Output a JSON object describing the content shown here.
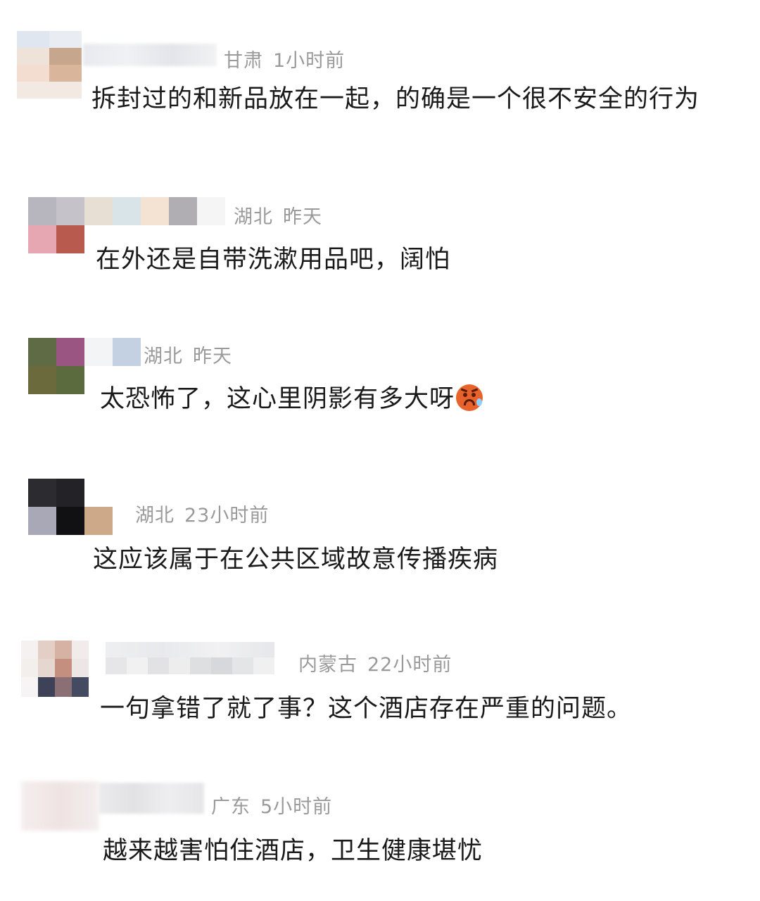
{
  "comments": [
    {
      "region": "甘肃",
      "time": "1小时前",
      "text": "拆封过的和新品放在一起，的确是一个很不安全的行为"
    },
    {
      "region": "湖北",
      "time": "昨天",
      "text": "在外还是自带洗漱用品吧，阔怕"
    },
    {
      "region": "湖北",
      "time": "昨天",
      "text": "太恐怖了，这心里阴影有多大呀",
      "emoji": "angry-crying-emoji-icon"
    },
    {
      "region": "湖北",
      "time": "23小时前",
      "text": "这应该属于在公共区域故意传播疾病"
    },
    {
      "region": "内蒙古",
      "time": "22小时前",
      "text": "一句拿错了就了事？这个酒店存在严重的问题。"
    },
    {
      "region": "广东",
      "time": "5小时前",
      "text": "越来越害怕住酒店，卫生健康堪忧"
    }
  ],
  "colors": {
    "meta": "#9a9a9a",
    "text": "#1a1a1a",
    "emoji": "#e8632b"
  }
}
